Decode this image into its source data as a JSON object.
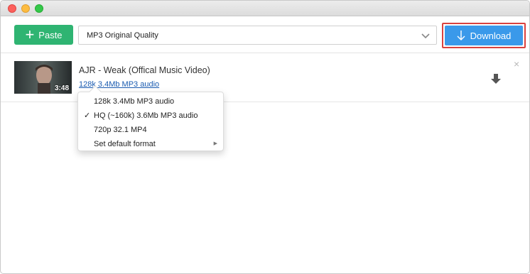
{
  "toolbar": {
    "paste_label": "Paste",
    "quality_value": "MP3 Original Quality",
    "download_label": "Download"
  },
  "item": {
    "title": "AJR - Weak (Offical Music Video)",
    "format_link": "128k 3.4Mb MP3 audio",
    "duration": "3:48"
  },
  "menu": {
    "items": [
      {
        "label": "128k 3.4Mb MP3 audio",
        "checked": false
      },
      {
        "label": "HQ (~160k) 3.6Mb MP3 audio",
        "checked": true
      },
      {
        "label": "720p 32.1 MP4",
        "checked": false
      },
      {
        "label": "Set default format",
        "checked": false,
        "submenu": true
      }
    ],
    "check_glyph": "✓",
    "submenu_glyph": "▶"
  },
  "colors": {
    "paste_green": "#2fb472",
    "download_blue": "#3a99ea",
    "highlight_red": "#d9413e",
    "link_blue": "#1a5bb0"
  },
  "icons": {
    "paste": "plus-icon",
    "select": "chevron-down-icon",
    "download": "arrow-down-icon",
    "item_download": "download-arrow-icon",
    "item_close": "close-icon"
  },
  "close_glyph": "×"
}
